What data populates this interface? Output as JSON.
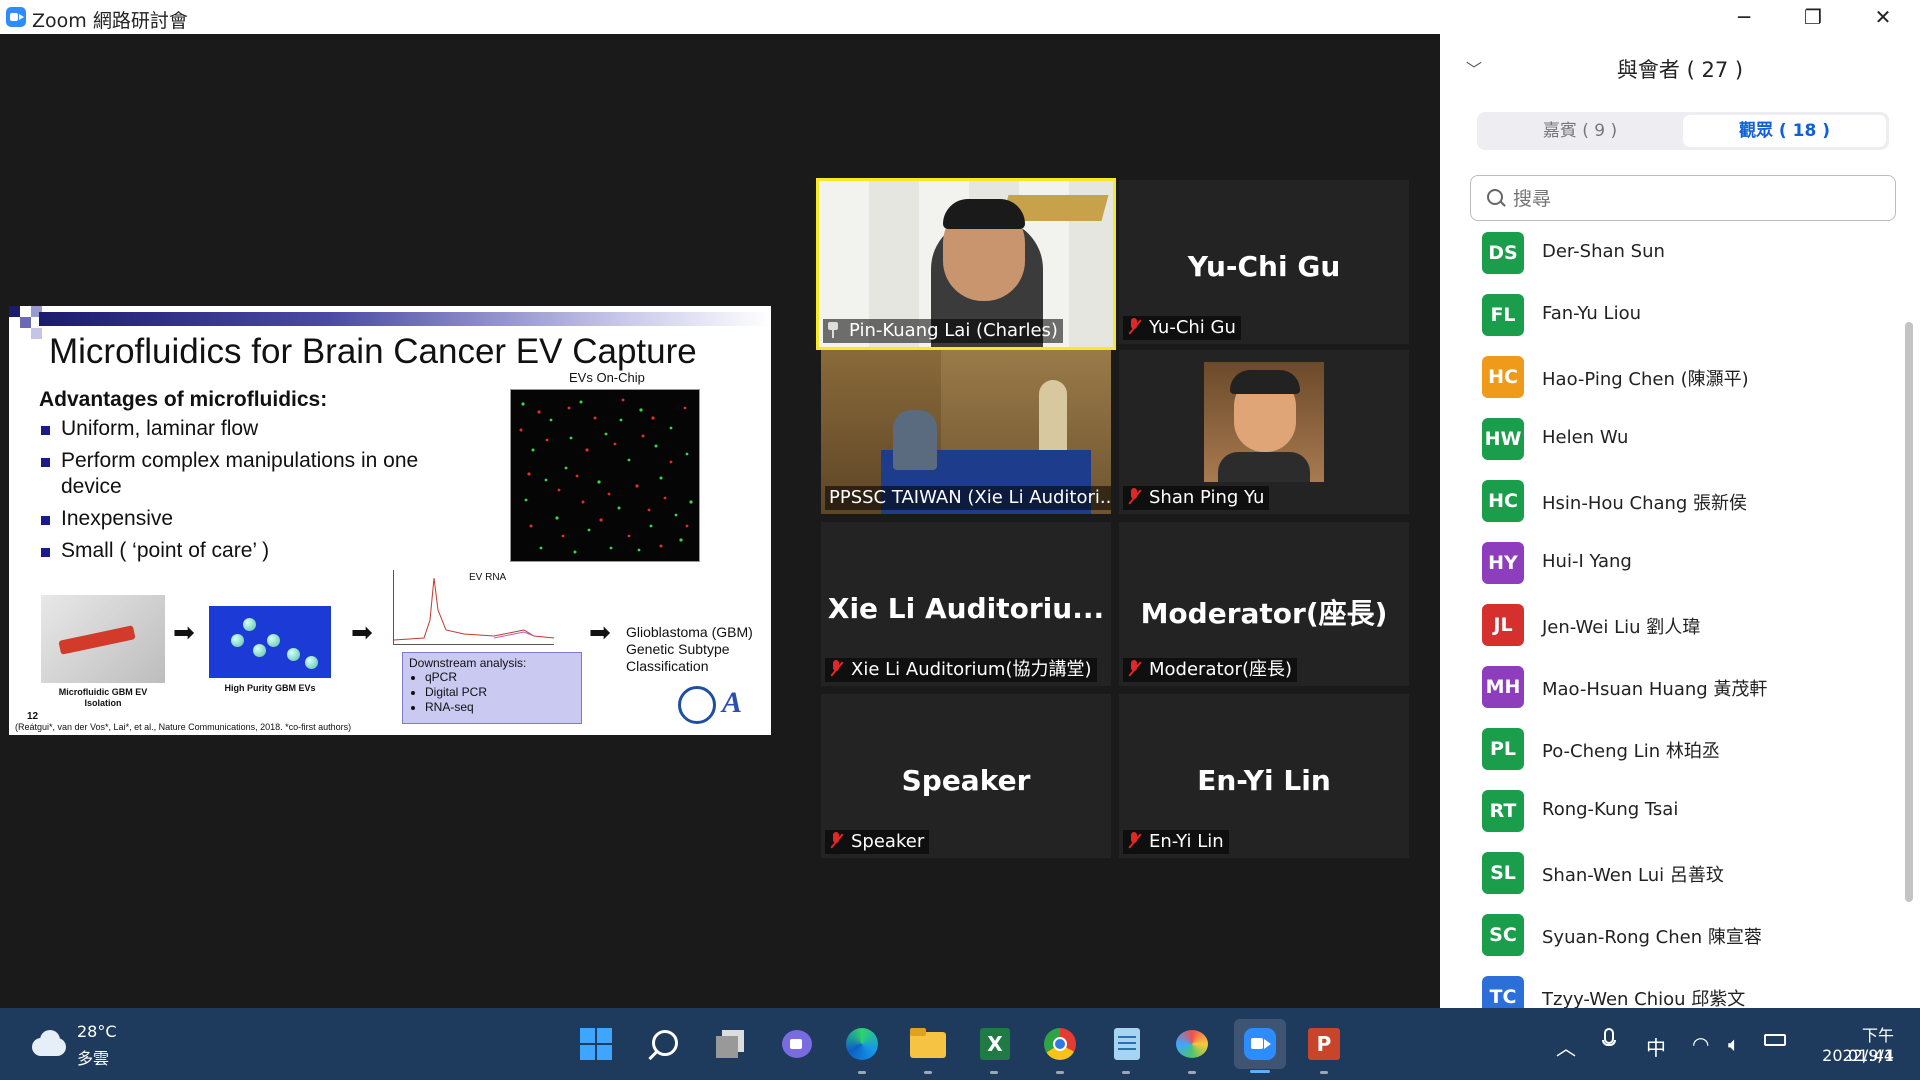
{
  "window": {
    "title": "Zoom 網路研討會",
    "minimize": "─",
    "restore": "❐",
    "close": "✕"
  },
  "slide": {
    "title": "Microfluidics for Brain Cancer EV Capture",
    "advantages_heading": "Advantages of microfluidics:",
    "bullets": [
      "Uniform, laminar flow",
      "Perform complex manipulations in one device",
      "Inexpensive",
      "Small ( ‘point of care’ )"
    ],
    "ev_caption": "EVs On-Chip",
    "device_caption": "Microfluidic GBM EV Isolation",
    "gbm_caption": "High Purity GBM EVs",
    "plot_label": "EV RNA",
    "downstream_title": "Downstream analysis:",
    "downstream_items": [
      "qPCR",
      "Digital PCR",
      "RNA-seq"
    ],
    "result_text": "Glioblastoma (GBM) Genetic Subtype Classification",
    "page_number": "12",
    "citation": "(Reátgui*, van der Vos*, Lai*, et al., Nature Communications, 2018. *co-first authors)"
  },
  "tiles": [
    {
      "id": "pinkuang",
      "name": "",
      "label": "Pin-Kuang Lai (Charles)",
      "icon": "pin-icon"
    },
    {
      "id": "yuchi",
      "name": "Yu-Chi Gu",
      "label": "Yu-Chi Gu",
      "icon": "mic-muted-icon"
    },
    {
      "id": "ppssc",
      "name": "",
      "label": "PPSSC TAIWAN (Xie Li Auditori...",
      "icon": ""
    },
    {
      "id": "shanping",
      "name": "",
      "label": "Shan Ping Yu",
      "icon": "mic-muted-icon"
    },
    {
      "id": "xieli",
      "name": "Xie Li Auditoriu...",
      "label": "Xie Li Auditorium(協力講堂)",
      "icon": "mic-muted-icon"
    },
    {
      "id": "moderator",
      "name": "Moderator(座長)",
      "label": "Moderator(座長)",
      "icon": "mic-muted-icon"
    },
    {
      "id": "speaker",
      "name": "Speaker",
      "label": "Speaker",
      "icon": "mic-muted-icon"
    },
    {
      "id": "enyi",
      "name": "En-Yi Lin",
      "label": "En-Yi Lin",
      "icon": "mic-muted-icon"
    }
  ],
  "panel": {
    "title": "與會者 ( 27 )",
    "collapse_icon": "chevron-down-icon",
    "tab_panelists": "嘉賓 ( 9 )",
    "tab_attendees": "觀眾 ( 18 )",
    "search_placeholder": "搜尋",
    "participants": [
      {
        "initials": "DS",
        "name": "Der-Shan Sun",
        "color": "#1a9e4b"
      },
      {
        "initials": "FL",
        "name": "Fan-Yu Liou",
        "color": "#1a9e4b"
      },
      {
        "initials": "HC",
        "name": "Hao-Ping Chen (陳灝平)",
        "color": "#ef9a1a"
      },
      {
        "initials": "HW",
        "name": "Helen Wu",
        "color": "#1a9e4b"
      },
      {
        "initials": "HC",
        "name": "Hsin-Hou Chang 張新侯",
        "color": "#1a9e4b"
      },
      {
        "initials": "HY",
        "name": "Hui-I Yang",
        "color": "#8e3dbd"
      },
      {
        "initials": "JL",
        "name": "Jen-Wei Liu 劉人瑋",
        "color": "#d6302e"
      },
      {
        "initials": "MH",
        "name": "Mao-Hsuan Huang 黃茂軒",
        "color": "#8e3dbd"
      },
      {
        "initials": "PL",
        "name": "Po-Cheng Lin 林珀丞",
        "color": "#1a9e4b"
      },
      {
        "initials": "RT",
        "name": "Rong-Kung Tsai",
        "color": "#1a9e4b"
      },
      {
        "initials": "SL",
        "name": "Shan-Wen Lui 呂善玟",
        "color": "#1a9e4b"
      },
      {
        "initials": "SC",
        "name": "Syuan-Rong Chen 陳宣蓉",
        "color": "#1a9e4b"
      },
      {
        "initials": "TC",
        "name": "Tzyy-Wen Chiou 邱紫文",
        "color": "#2d6fd8"
      }
    ]
  },
  "taskbar": {
    "temperature": "28°C",
    "condition": "多雲",
    "ime": "中",
    "time": "下午 01:41",
    "date": "2022/9/4"
  }
}
